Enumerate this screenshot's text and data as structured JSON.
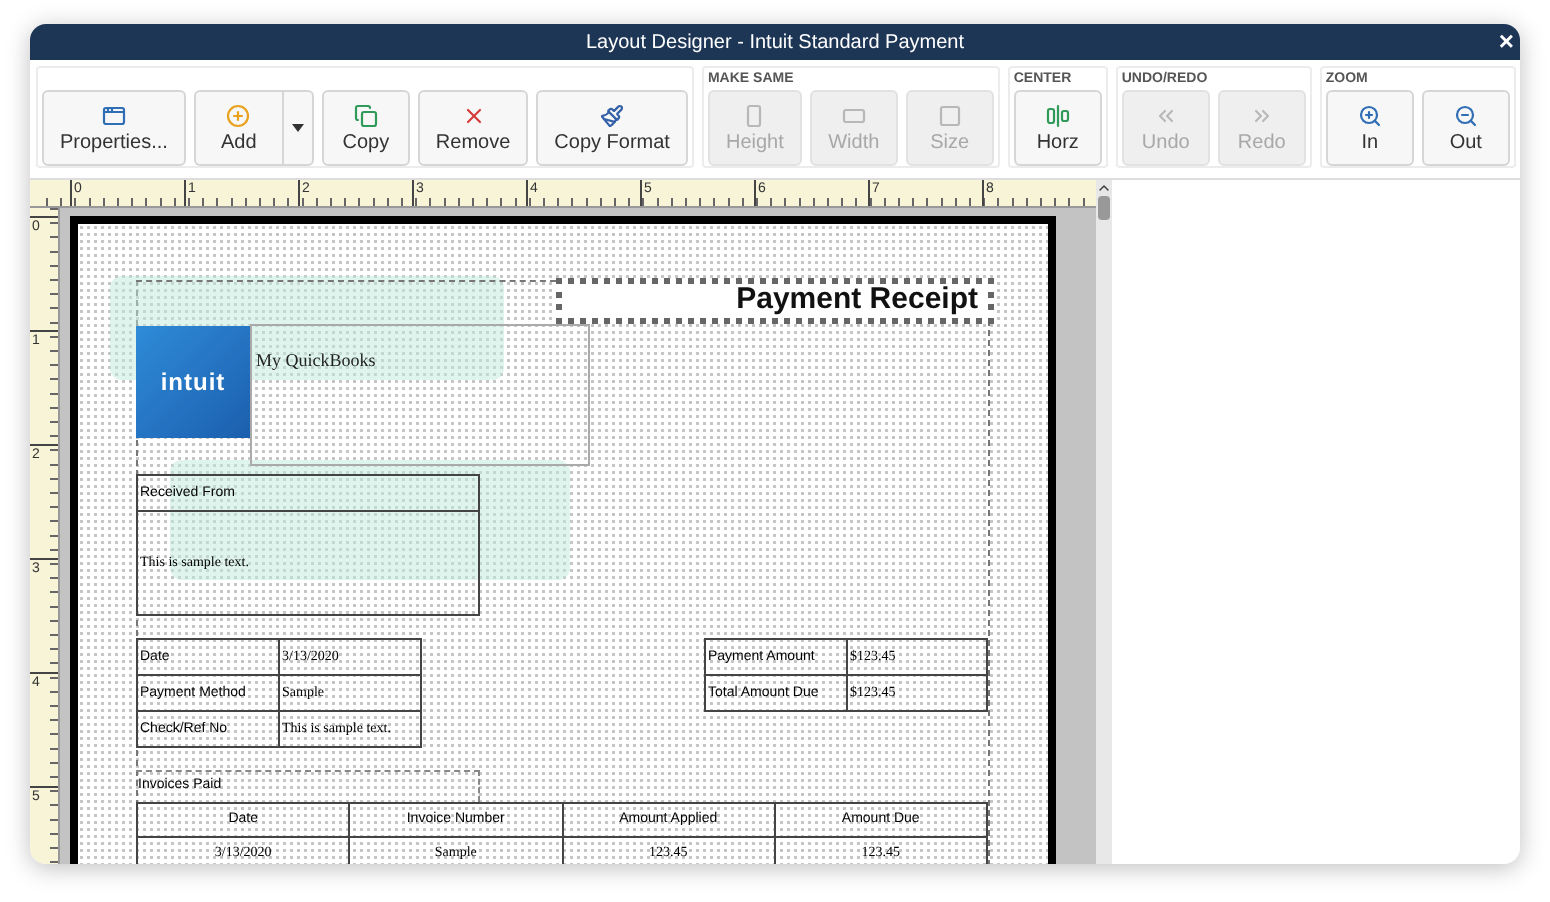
{
  "window": {
    "title": "Layout Designer - Intuit Standard Payment",
    "close": "×"
  },
  "toolbar": {
    "groups": [
      {
        "buttons": [
          {
            "label": "Properties...",
            "disabled": false
          },
          {
            "label": "Add",
            "disabled": false,
            "dropdown": true
          },
          {
            "label": "Copy",
            "disabled": false
          },
          {
            "label": "Remove",
            "disabled": false
          },
          {
            "label": "Copy Format",
            "disabled": false
          }
        ]
      },
      {
        "title": "MAKE SAME",
        "buttons": [
          {
            "label": "Height",
            "disabled": true
          },
          {
            "label": "Width",
            "disabled": true
          },
          {
            "label": "Size",
            "disabled": true
          }
        ]
      },
      {
        "title": "CENTER",
        "buttons": [
          {
            "label": "Horz",
            "disabled": false
          }
        ]
      },
      {
        "title": "UNDO/REDO",
        "buttons": [
          {
            "label": "Undo",
            "disabled": true
          },
          {
            "label": "Redo",
            "disabled": true
          }
        ]
      },
      {
        "title": "ZOOM",
        "buttons": [
          {
            "label": "In",
            "disabled": false
          },
          {
            "label": "Out",
            "disabled": false
          }
        ]
      }
    ]
  },
  "ruler": {
    "horizontal": [
      "0",
      "1",
      "2",
      "3",
      "4",
      "5",
      "6",
      "7",
      "8"
    ],
    "vertical": [
      "0",
      "1",
      "2",
      "3",
      "4",
      "5"
    ]
  },
  "form": {
    "logo": "intuit",
    "company": "My QuickBooks",
    "heading": {
      "text": "Payment Receipt",
      "selected": true
    },
    "received_from": {
      "header": "Received From",
      "body": "This is sample text."
    },
    "details": [
      {
        "label": "Date",
        "value": "3/13/2020"
      },
      {
        "label": "Payment Method",
        "value": "Sample"
      },
      {
        "label": "Check/Ref No",
        "value": "This is sample text."
      }
    ],
    "amounts": [
      {
        "label": "Payment Amount",
        "value": "$123.45"
      },
      {
        "label": "Total Amount Due",
        "value": "$123.45"
      }
    ],
    "invoices_label": "Invoices Paid",
    "invoices": {
      "columns": [
        "Date",
        "Invoice Number",
        "Amount Applied",
        "Amount Due"
      ],
      "rows": [
        [
          "3/13/2020",
          "Sample",
          "123.45",
          "123.45"
        ]
      ]
    }
  }
}
